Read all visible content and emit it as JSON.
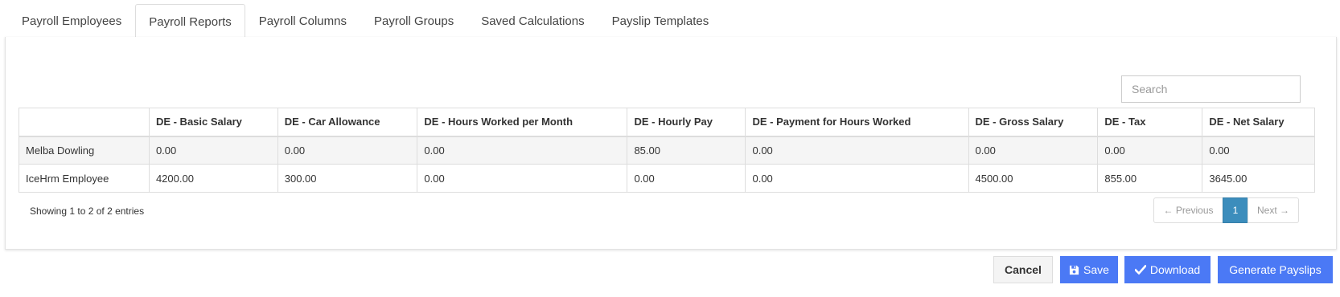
{
  "tabs": [
    {
      "label": "Payroll Employees",
      "active": false
    },
    {
      "label": "Payroll Reports",
      "active": true
    },
    {
      "label": "Payroll Columns",
      "active": false
    },
    {
      "label": "Payroll Groups",
      "active": false
    },
    {
      "label": "Saved Calculations",
      "active": false
    },
    {
      "label": "Payslip Templates",
      "active": false
    }
  ],
  "search": {
    "placeholder": "Search",
    "value": ""
  },
  "table": {
    "columns": [
      "",
      "DE - Basic Salary",
      "DE - Car Allowance",
      "DE - Hours Worked per Month",
      "DE - Hourly Pay",
      "DE - Payment for Hours Worked",
      "DE - Gross Salary",
      "DE - Tax",
      "DE - Net Salary"
    ],
    "rows": [
      [
        "Melba Dowling",
        "0.00",
        "0.00",
        "0.00",
        "85.00",
        "0.00",
        "0.00",
        "0.00",
        "0.00"
      ],
      [
        "IceHrm Employee",
        "4200.00",
        "300.00",
        "0.00",
        "0.00",
        "0.00",
        "4500.00",
        "855.00",
        "3645.00"
      ]
    ]
  },
  "pagination": {
    "info": "Showing 1 to 2 of 2 entries",
    "previous": "← Previous",
    "current_page": "1",
    "next": "Next →"
  },
  "actions": {
    "cancel": "Cancel",
    "save": "Save",
    "download": "Download",
    "generate": "Generate Payslips"
  },
  "colors": {
    "primary_button": "#4b79f5",
    "active_page": "#3c8dbc"
  },
  "icons": {
    "save": "floppy-disk-icon",
    "download": "checkmark-icon"
  }
}
